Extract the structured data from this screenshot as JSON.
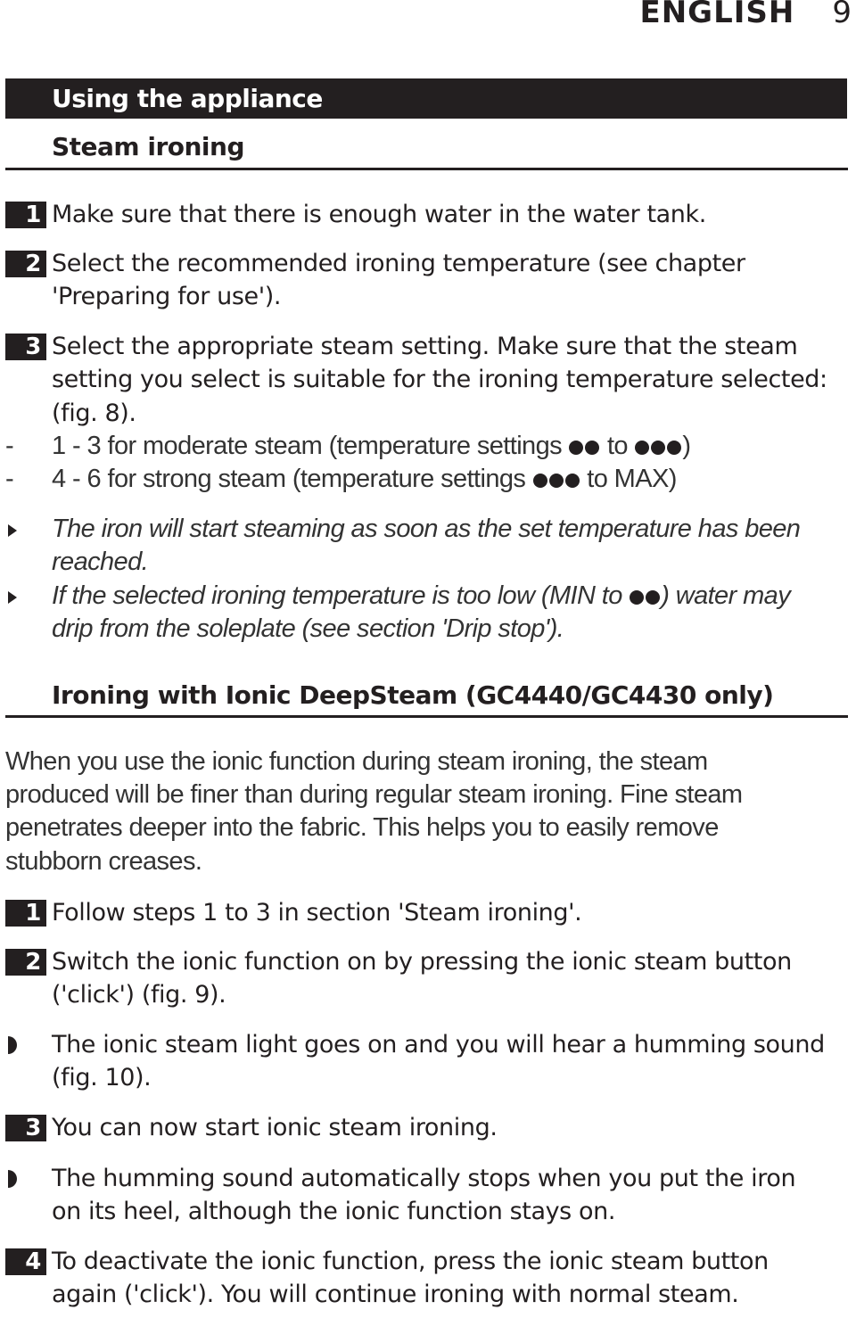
{
  "running_head": {
    "language": "ENGLISH",
    "page_number": "9"
  },
  "chapter": {
    "title": "Using the appliance"
  },
  "steam_ironing": {
    "title": "Steam ironing",
    "steps": [
      {
        "number": "1",
        "lines": [
          "Make sure that there is enough water in the water tank."
        ]
      },
      {
        "number": "2",
        "lines": [
          "Select the recommended ironing temperature (see chapter",
          "'Preparing for use')."
        ]
      },
      {
        "number": "3",
        "lines": [
          "Select the appropriate steam setting. Make sure that the steam",
          "setting you select is suitable for the ironing temperature selected:",
          "(fig. 8)."
        ]
      }
    ],
    "dash_items": [
      {
        "marker": "-",
        "text_before": "1 - 3 for moderate steam (temperature settings",
        "dots_a": 2,
        "text_mid": "to",
        "dots_b": 3,
        "text_after": ")"
      },
      {
        "marker": "-",
        "text_before": "4 - 6 for strong steam (temperature settings",
        "dots_a": 3,
        "text_mid": "to MAX)",
        "dots_b": 0,
        "text_after": ""
      }
    ],
    "notes": [
      {
        "lines": [
          "The iron will start steaming as soon as the set temperature has been",
          "reached."
        ]
      },
      {
        "line1_before": "If the selected ironing temperature is too low (MIN to",
        "dots": 2,
        "line1_after": ") water may",
        "line2": "drip from the soleplate (see section 'Drip stop')."
      }
    ]
  },
  "ionic_section": {
    "title": "Ironing with Ionic DeepSteam (GC4440/GC4430 only)",
    "intro_lines": [
      "When you use the ionic function during steam ironing, the steam",
      "produced will be finer than during regular steam ironing. Fine steam",
      "penetrates deeper into the fabric. This helps you to easily remove",
      "stubborn creases."
    ],
    "steps": [
      {
        "number": "1",
        "lines": [
          "Follow steps 1 to 3 in section 'Steam ironing'."
        ]
      },
      {
        "number": "2",
        "lines": [
          "Switch the ionic function on by pressing the ionic steam button",
          "('click') (fig. 9)."
        ]
      },
      {
        "result": true,
        "lines": [
          "The ionic steam light goes on and you will hear a humming sound",
          "(fig. 10)."
        ]
      },
      {
        "number": "3",
        "lines": [
          "You can now start ionic steam ironing."
        ]
      },
      {
        "result": true,
        "lines": [
          "The humming sound automatically stops when you put the iron",
          "on its heel, although the ionic function stays on."
        ]
      },
      {
        "number": "4",
        "lines": [
          "To deactivate the ionic function, press the ionic steam button",
          "again ('click'). You will continue ironing with normal steam."
        ]
      }
    ]
  }
}
